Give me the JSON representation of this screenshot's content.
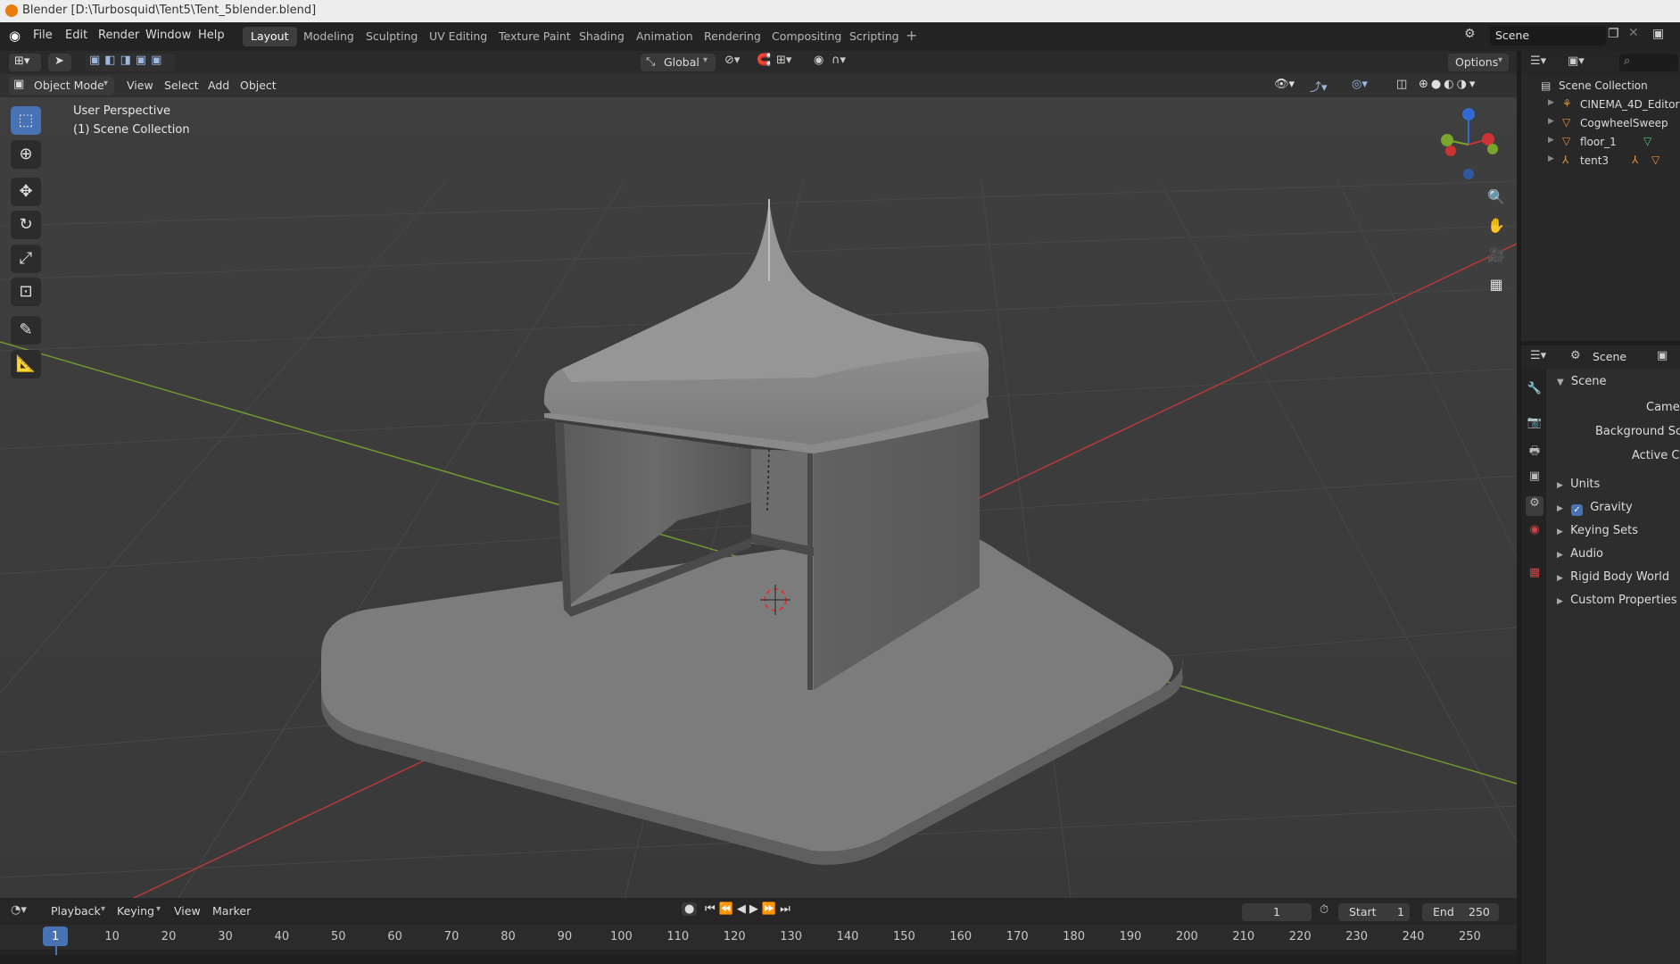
{
  "window": {
    "title": "Blender [D:\\Turbosquid\\Tent5\\Tent_5blender.blend]"
  },
  "menu": {
    "items": [
      "File",
      "Edit",
      "Render",
      "Window",
      "Help"
    ]
  },
  "workspaces": {
    "tabs": [
      "Layout",
      "Modeling",
      "Sculpting",
      "UV Editing",
      "Texture Paint",
      "Shading",
      "Animation",
      "Rendering",
      "Compositing",
      "Scripting"
    ],
    "active": "Layout",
    "add_symbol": "+"
  },
  "scene_selector": {
    "value": "Scene"
  },
  "toolbar": {
    "transform_orientation": "Global",
    "options_label": "Options"
  },
  "viewport_header": {
    "mode": "Object Mode",
    "menus": [
      "View",
      "Select",
      "Add",
      "Object"
    ]
  },
  "viewport": {
    "overlay_line1": "User Perspective",
    "overlay_line2": "(1) Scene Collection"
  },
  "outliner": {
    "root": "Scene Collection",
    "items": [
      {
        "name": "CINEMA_4D_Editor",
        "icon": "empty-icon"
      },
      {
        "name": "CogwheelSweep",
        "icon": "mesh-icon"
      },
      {
        "name": "floor_1",
        "icon": "mesh-icon"
      },
      {
        "name": "tent3",
        "icon": "armature-icon"
      }
    ]
  },
  "properties": {
    "header": "Scene",
    "panel_title": "Scene",
    "fields": [
      "Camera",
      "Background Scene",
      "Active Clip"
    ],
    "panels": [
      "Units",
      "Gravity",
      "Keying Sets",
      "Audio",
      "Rigid Body World",
      "Custom Properties"
    ],
    "gravity_checked": true
  },
  "timeline": {
    "menus": [
      "Playback",
      "Keying",
      "View",
      "Marker"
    ],
    "current_frame": "1",
    "start_label": "Start",
    "start_value": "1",
    "end_label": "End",
    "end_value": "250",
    "ticks": [
      "1",
      "10",
      "20",
      "30",
      "40",
      "50",
      "60",
      "70",
      "80",
      "90",
      "100",
      "110",
      "120",
      "130",
      "140",
      "150",
      "160",
      "170",
      "180",
      "190",
      "200",
      "210",
      "220",
      "230",
      "240",
      "250"
    ]
  },
  "colors": {
    "accent": "#4772b3",
    "viewport_bg": "#3d3d3d",
    "x_axis": "#b83a3a",
    "y_axis": "#6e9a2f"
  }
}
